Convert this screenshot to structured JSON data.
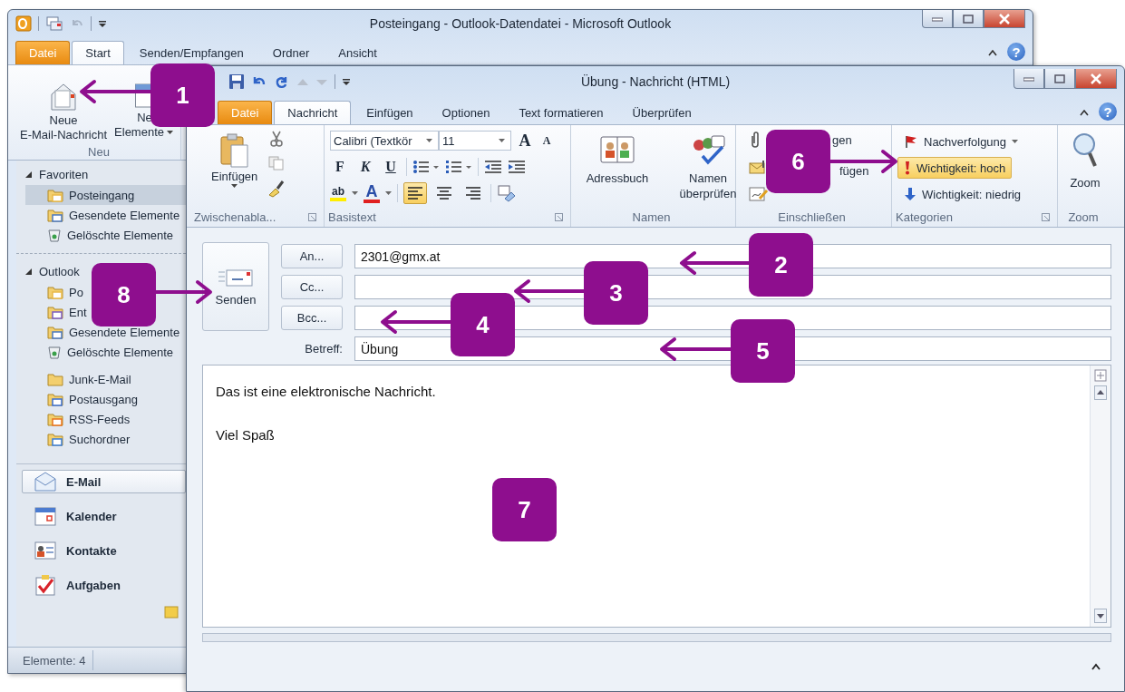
{
  "outlook_window": {
    "title": "Posteingang - Outlook-Datendatei - Microsoft Outlook",
    "tabs": [
      {
        "label": "Datei",
        "kind": "file",
        "selected": false
      },
      {
        "label": "Start",
        "kind": "tab",
        "selected": true
      },
      {
        "label": "Senden/Empfangen",
        "kind": "tab",
        "selected": false
      },
      {
        "label": "Ordner",
        "kind": "tab",
        "selected": false
      },
      {
        "label": "Ansicht",
        "kind": "tab",
        "selected": false
      }
    ],
    "help": "?",
    "ribbon_group": {
      "label": "Neu",
      "buttons": [
        {
          "kind": "new-mail",
          "lines": [
            "Neue",
            "E-Mail-Nachricht"
          ]
        },
        {
          "kind": "new-items",
          "lines": [
            "Ne",
            "Elemente"
          ],
          "dropdown": true
        }
      ]
    },
    "folder_pane": [
      {
        "label": "Favoriten",
        "expanded": true,
        "children": [
          {
            "label": "Posteingang",
            "kind": "inbox",
            "selected": true
          },
          {
            "label": "Gesendete Elemente",
            "kind": "sent",
            "selected": false
          },
          {
            "label": "Gelöschte Elemente",
            "kind": "deleted",
            "selected": false
          }
        ]
      },
      {
        "label": "Outlook",
        "expanded": true,
        "children": [
          {
            "label": "Po",
            "kind": "inbox",
            "selected": false
          },
          {
            "label": "Ent",
            "kind": "drafts",
            "selected": false
          },
          {
            "label": "Gesendete Elemente",
            "kind": "sent",
            "selected": false
          },
          {
            "label": "Gelöschte Elemente",
            "kind": "deleted",
            "selected": false
          },
          {
            "label": "Junk-E-Mail",
            "kind": "junk",
            "selected": false
          },
          {
            "label": "Postausgang",
            "kind": "outbox",
            "selected": false
          },
          {
            "label": "RSS-Feeds",
            "kind": "rss",
            "selected": false
          },
          {
            "label": "Suchordner",
            "kind": "search",
            "selected": false
          }
        ]
      }
    ],
    "modules": [
      {
        "label": "E-Mail",
        "kind": "mail",
        "selected": true
      },
      {
        "label": "Kalender",
        "kind": "calendar",
        "selected": false
      },
      {
        "label": "Kontakte",
        "kind": "contacts",
        "selected": false
      },
      {
        "label": "Aufgaben",
        "kind": "tasks",
        "selected": false
      }
    ],
    "status_bar": "Elemente: 4"
  },
  "message_window": {
    "title": "Übung  -  Nachricht (HTML)",
    "tabs": [
      {
        "label": "Datei",
        "kind": "file",
        "selected": false
      },
      {
        "label": "Nachricht",
        "kind": "tab",
        "selected": true
      },
      {
        "label": "Einfügen",
        "kind": "tab",
        "selected": false
      },
      {
        "label": "Optionen",
        "kind": "tab",
        "selected": false
      },
      {
        "label": "Text formatieren",
        "kind": "tab",
        "selected": false
      },
      {
        "label": "Überprüfen",
        "kind": "tab",
        "selected": false
      }
    ],
    "help": "?",
    "clipboard": {
      "label": "Zwischenabla...",
      "paste": "Einfügen"
    },
    "basic_text": {
      "label": "Basistext",
      "font": "Calibri (Textkör",
      "size": "11",
      "grow": "A",
      "shrink": "A",
      "bold": "F",
      "italic": "K",
      "underline": "U",
      "highlight": "ab",
      "font_color": "A",
      "alignment": [
        {
          "kind": "left",
          "selected": true
        },
        {
          "kind": "center",
          "selected": false
        },
        {
          "kind": "right",
          "selected": false
        }
      ]
    },
    "names": {
      "label": "Namen",
      "buttons": [
        {
          "kind": "address-book",
          "label": "Adressbuch"
        },
        {
          "kind": "check-names",
          "label": "Namen überprüfen"
        }
      ]
    },
    "include": {
      "label": "Einschließen",
      "items": [
        {
          "kind": "attach",
          "label": "gen"
        },
        {
          "kind": "item",
          "label": "fügen"
        },
        {
          "kind": "signature"
        }
      ]
    },
    "tags": {
      "label": "Kategorien",
      "items": [
        {
          "kind": "flag",
          "label": "Nachverfolgung",
          "dropdown": true,
          "selected": false
        },
        {
          "kind": "high",
          "label": "Wichtigkeit: hoch",
          "selected": true
        },
        {
          "kind": "low",
          "label": "Wichtigkeit: niedrig",
          "selected": false
        }
      ]
    },
    "zoom": {
      "label": "Zoom",
      "button": "Zoom"
    },
    "send_button": "Senden",
    "fields": [
      {
        "label": "An...",
        "kind": "button",
        "value": "2301@gmx.at"
      },
      {
        "label": "Cc...",
        "kind": "button"
      },
      {
        "label": "Bcc...",
        "kind": "button"
      },
      {
        "label": "Betreff:",
        "kind": "label",
        "value": "Übung"
      }
    ],
    "body": [
      "Das ist eine elektronische Nachricht.",
      "Viel Spaß"
    ]
  },
  "callouts": [
    {
      "number": "1"
    },
    {
      "number": "2"
    },
    {
      "number": "3"
    },
    {
      "number": "4"
    },
    {
      "number": "5"
    },
    {
      "number": "6"
    },
    {
      "number": "7"
    },
    {
      "number": "8"
    }
  ]
}
